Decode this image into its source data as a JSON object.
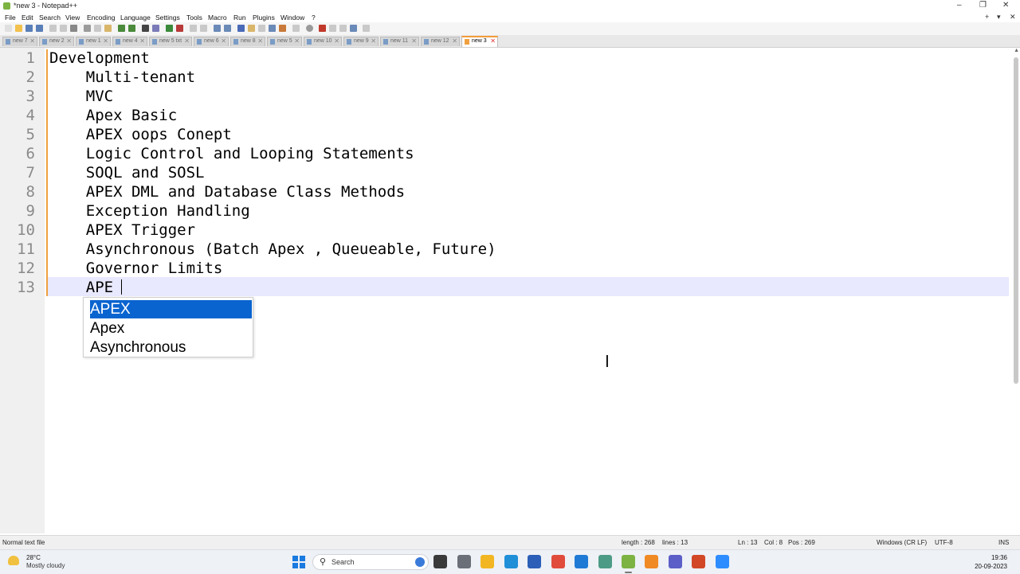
{
  "window": {
    "title": "*new 3 - Notepad++",
    "controls": {
      "minimize": "–",
      "restore": "❐",
      "close": "✕"
    }
  },
  "menu": {
    "items": [
      "File",
      "Edit",
      "Search",
      "View",
      "Encoding",
      "Language",
      "Settings",
      "Tools",
      "Macro",
      "Run",
      "Plugins",
      "Window",
      "?"
    ],
    "right": {
      "add": "+",
      "dropdown": "▾",
      "close": "✕"
    }
  },
  "tabs": [
    {
      "label": "new 7"
    },
    {
      "label": "new 2"
    },
    {
      "label": "new 1"
    },
    {
      "label": "new 4"
    },
    {
      "label": "new 5 txt"
    },
    {
      "label": "new 6"
    },
    {
      "label": "new 8"
    },
    {
      "label": "new 5"
    },
    {
      "label": "new 10"
    },
    {
      "label": "new 9"
    },
    {
      "label": "new 11"
    },
    {
      "label": "new 12"
    },
    {
      "label": "new 3",
      "active": true
    }
  ],
  "editor": {
    "lines": [
      {
        "num": "1",
        "text": "Development"
      },
      {
        "num": "2",
        "text": "    Multi-tenant"
      },
      {
        "num": "3",
        "text": "    MVC"
      },
      {
        "num": "4",
        "text": "    Apex Basic"
      },
      {
        "num": "5",
        "text": "    APEX oops Conept"
      },
      {
        "num": "6",
        "text": "    Logic Control and Looping Statements"
      },
      {
        "num": "7",
        "text": "    SOQL and SOSL"
      },
      {
        "num": "8",
        "text": "    APEX DML and Database Class Methods"
      },
      {
        "num": "9",
        "text": "    Exception Handling"
      },
      {
        "num": "10",
        "text": "    APEX Trigger"
      },
      {
        "num": "11",
        "text": "    Asynchronous (Batch Apex , Queueable, Future)"
      },
      {
        "num": "12",
        "text": "    Governor Limits"
      },
      {
        "num": "13",
        "text": "    APE"
      }
    ],
    "current_line": 13,
    "autocomplete": {
      "items": [
        "APEX",
        "Apex",
        "Asynchronous"
      ],
      "selected_index": 0
    }
  },
  "statusbar": {
    "file_type": "Normal text file",
    "length": "length : 268",
    "lines": "lines : 13",
    "ln": "Ln : 13",
    "col": "Col : 8",
    "pos": "Pos : 269",
    "eol": "Windows (CR LF)",
    "encoding": "UTF-8",
    "mode": "INS"
  },
  "taskbar": {
    "weather_temp": "28°C",
    "weather_desc": "Mostly cloudy",
    "search_label": "Search",
    "clock_time": "19:36",
    "clock_date": "20-09-2023",
    "apps": [
      {
        "name": "task-view-icon",
        "color": "#3a3a3a"
      },
      {
        "name": "file-explorer-icon",
        "color": "#f2b622"
      },
      {
        "name": "edge-icon",
        "color": "#1f8fd8"
      },
      {
        "name": "store-icon",
        "color": "#2b5fb8"
      },
      {
        "name": "chrome-icon",
        "color": "#e14b3c"
      },
      {
        "name": "vscode-icon",
        "color": "#1f7ad6"
      },
      {
        "name": "chatgpt-icon",
        "color": "#4c9b86"
      },
      {
        "name": "notepadpp-icon",
        "color": "#7cb342"
      },
      {
        "name": "sublime-icon",
        "color": "#f08a24"
      },
      {
        "name": "teams-icon",
        "color": "#5b5fc7"
      },
      {
        "name": "powerpoint-icon",
        "color": "#d24726"
      },
      {
        "name": "zoom-icon",
        "color": "#2d8cff"
      }
    ]
  },
  "colors": {
    "accent_orange": "#f0a040",
    "current_line": "#e8e8ff",
    "selection_blue": "#0a64d0"
  }
}
